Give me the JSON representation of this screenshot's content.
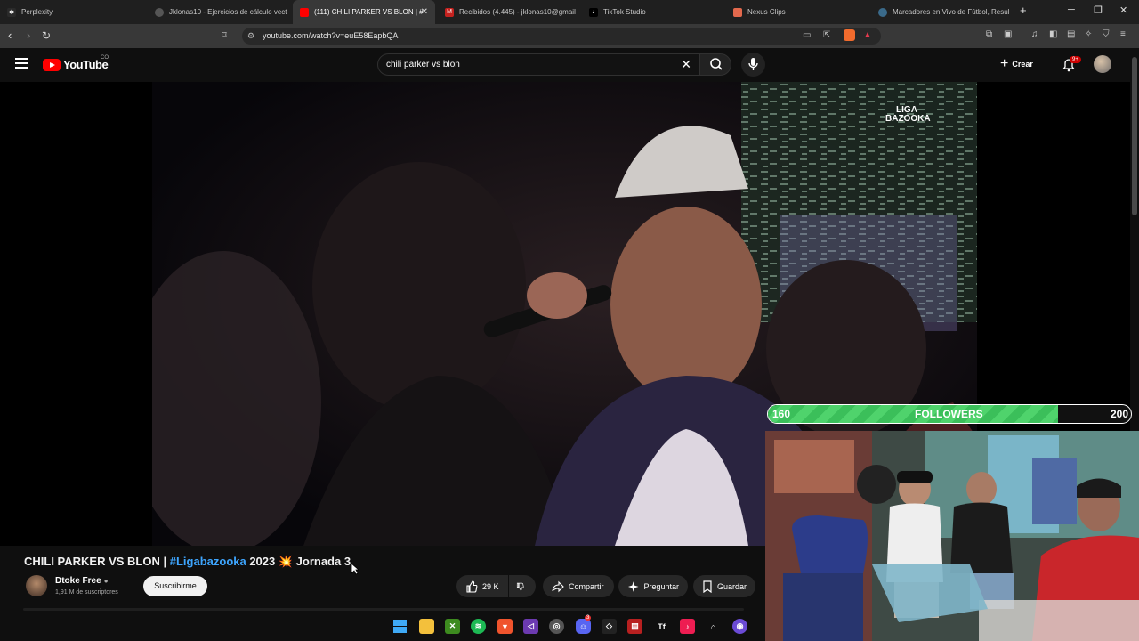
{
  "tabs": [
    {
      "title": "Perplexity",
      "icon": "perplexity-icon",
      "active": false
    },
    {
      "title": "Jklonas10 - Ejercicios de cálculo vect",
      "icon": "globe-icon",
      "active": false
    },
    {
      "title": "(111) CHILI PARKER VS BLON | #",
      "icon": "youtube-icon",
      "active": true
    },
    {
      "title": "Recibidos (4.445) - jklonas10@gmail",
      "icon": "gmail-icon",
      "active": false
    },
    {
      "title": "TikTok Studio",
      "icon": "tiktok-icon",
      "active": false
    },
    {
      "title": "Nexus Clips",
      "icon": "nexus-icon",
      "active": false
    },
    {
      "title": "Marcadores en Vivo de Fútbol, Resul",
      "icon": "globe-icon",
      "active": false
    }
  ],
  "address": {
    "url": "youtube.com/watch?v=euE58EapbQA"
  },
  "header": {
    "logo_text": "YouTube",
    "country_code": "CO",
    "search_value": "chili parker vs blon",
    "create_label": "Crear",
    "notification_badge": "9+"
  },
  "video": {
    "watermark": [
      "LIGA",
      "BAZOOKA"
    ],
    "followers_bar": {
      "current": "160",
      "label": "FOLLOWERS",
      "goal": "200",
      "progress": 0.8
    }
  },
  "details": {
    "title_prefix": "CHILI PARKER VS BLON | ",
    "hashtag": "#Ligabazooka",
    "title_suffix": " 2023 💥  Jornada 3",
    "channel_name": "Dtoke Free",
    "subscribers": "1,91 M de suscriptores",
    "subscribe_label": "Suscribirme",
    "like_count": "29 K",
    "share_label": "Compartir",
    "ask_label": "Preguntar",
    "save_label": "Guardar"
  },
  "taskbar": {
    "apps": [
      "windows-start-icon",
      "file-explorer-icon",
      "xbox-icon",
      "spotify-icon",
      "brave-icon",
      "visual-studio-icon",
      "chrome-icon",
      "discord-icon",
      "capcut-icon",
      "news-icon",
      "typeface-icon",
      "tiktok-icon",
      "epic-icon",
      "obs-icon"
    ],
    "discord_badge": "3"
  },
  "colors": {
    "youtube_red": "#ff0000",
    "link_blue": "#3ea6ff",
    "followers_green": "#3bbf5a"
  }
}
